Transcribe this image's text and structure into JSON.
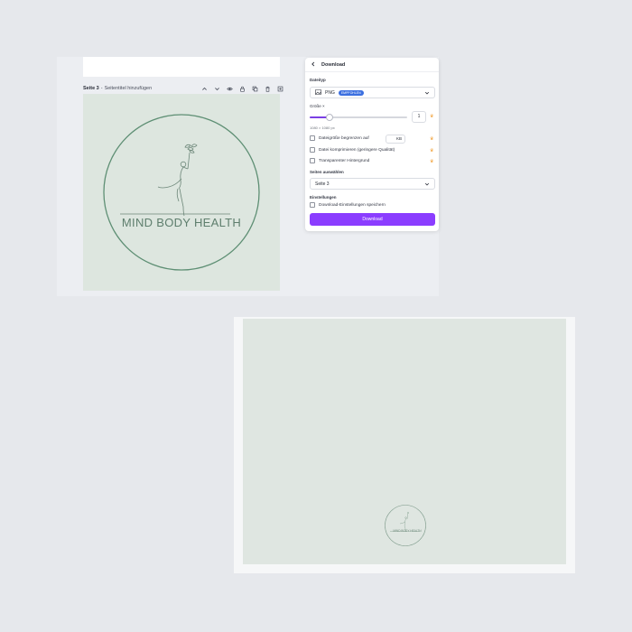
{
  "editor": {
    "page_label": "Seite 3",
    "page_separator": "-",
    "page_add_title": "Seitentitel hinzufügen",
    "page_tool_icons": [
      "chevron-up-icon",
      "chevron-down-icon",
      "eye-icon",
      "lock-icon",
      "duplicate-icon",
      "trash-icon",
      "add-page-icon"
    ]
  },
  "design": {
    "logo_text": "MIND BODY HEALTH",
    "background_color": "#dde6df",
    "line_color": "#5e7e6d"
  },
  "download_panel": {
    "title": "Download",
    "file_type_label": "Dateityp",
    "file_type_value": "PNG",
    "file_type_badge": "EMPFOHLEN",
    "size_label": "Größe ×",
    "size_value": "1",
    "dimensions": "1080 × 1080 px",
    "limit_label": "Dateigröße begrenzen auf",
    "limit_value": "KB",
    "compress_label": "Datei komprimieren (geringere Qualität)",
    "transparent_label": "Transparenter Hintergrund",
    "select_pages_label": "Seiten auswählen",
    "select_pages_value": "Seite 3",
    "settings_label": "Einstellungen",
    "save_settings_label": "Download-Einstellungen speichern",
    "download_button": "Download",
    "accent_color": "#8b3dff",
    "premium_color": "#f2a23b"
  },
  "bottom_card": {
    "logo_text": "MIND BODY HEALTH"
  }
}
